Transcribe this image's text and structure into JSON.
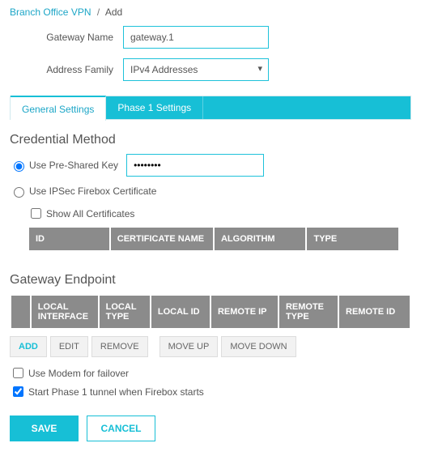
{
  "breadcrumb": {
    "parent": "Branch Office VPN",
    "current": "Add"
  },
  "form": {
    "gateway_name_label": "Gateway Name",
    "gateway_name_value": "gateway.1",
    "address_family_label": "Address Family",
    "address_family_value": "IPv4 Addresses"
  },
  "tabs": {
    "general": "General Settings",
    "phase1": "Phase 1 Settings"
  },
  "credential": {
    "title": "Credential Method",
    "psk_label": "Use Pre-Shared Key",
    "psk_value": "••••••••",
    "ipsec_label": "Use IPSec Firebox Certificate",
    "show_all_label": "Show All Certificates",
    "table": {
      "id": "ID",
      "cert_name": "CERTIFICATE NAME",
      "algorithm": "ALGORITHM",
      "type": "TYPE"
    }
  },
  "gateway_endpoint": {
    "title": "Gateway Endpoint",
    "table": {
      "local_interface": "LOCAL INTERFACE",
      "local_type": "LOCAL TYPE",
      "local_id": "LOCAL ID",
      "remote_ip": "REMOTE IP",
      "remote_type": "REMOTE TYPE",
      "remote_id": "REMOTE ID"
    },
    "buttons": {
      "add": "ADD",
      "edit": "EDIT",
      "remove": "REMOVE",
      "move_up": "MOVE UP",
      "move_down": "MOVE DOWN"
    }
  },
  "options": {
    "modem_failover": "Use Modem for failover",
    "start_phase1": "Start Phase 1 tunnel when Firebox starts"
  },
  "footer": {
    "save": "SAVE",
    "cancel": "CANCEL"
  }
}
